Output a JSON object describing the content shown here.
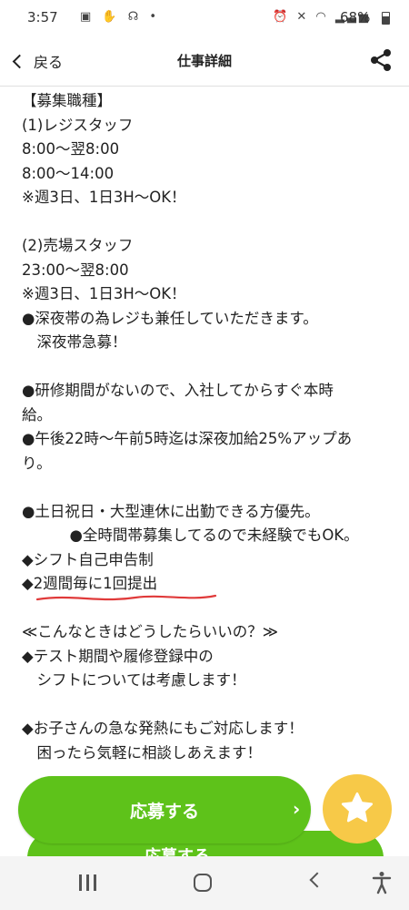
{
  "status_bar": {
    "time": "3:57",
    "battery": "68%",
    "left_icons": [
      "notification-icon",
      "hand-icon",
      "headset-icon",
      "dot-icon"
    ],
    "right_icons": [
      "alarm-icon",
      "mute-icon",
      "wifi-icon",
      "signal-icon",
      "battery-icon"
    ]
  },
  "header": {
    "back_label": "戻る",
    "title": "仕事詳細",
    "share_icon": "share-icon"
  },
  "content": {
    "lines": [
      "【募集職種】",
      "(1)レジスタッフ",
      "8:00〜翌8:00",
      "8:00〜14:00",
      "※週3日、1日3H〜OK！",
      "",
      "(2)売場スタッフ",
      "23:00〜翌8:00",
      "※週3日、1日3H〜OK！",
      "●深夜帯の為レジも兼任していただきます。",
      "　深夜帯急募！",
      "",
      "●研修期間がないので、入社してからすぐ本時",
      "給。",
      "●午後22時〜午前5時迄は深夜加給25%アップあ",
      "り。",
      "●全時間帯募集してるので未経験でもOK。",
      "●土日祝日・大型連休に出勤できる方優先。",
      "",
      "◆シフト自己申告制",
      "◆2週間毎に1回提出",
      "",
      "≪こんなときはどうしたらいいの？≫",
      "◆テスト期間や履修登録中の",
      "　シフトについては考慮します！",
      "",
      "◆お子さんの急な発熱にもご対応します！",
      "　困ったら気軽に相談しあえます！"
    ]
  },
  "actions": {
    "apply_label": "応募する",
    "apply_label_behind": "応募する",
    "apply_arrow": "›",
    "favorite_icon": "star-icon"
  },
  "colors": {
    "accent_green": "#5ec21a",
    "favorite_yellow": "#f7c948",
    "underline_red": "#e03a3a"
  }
}
